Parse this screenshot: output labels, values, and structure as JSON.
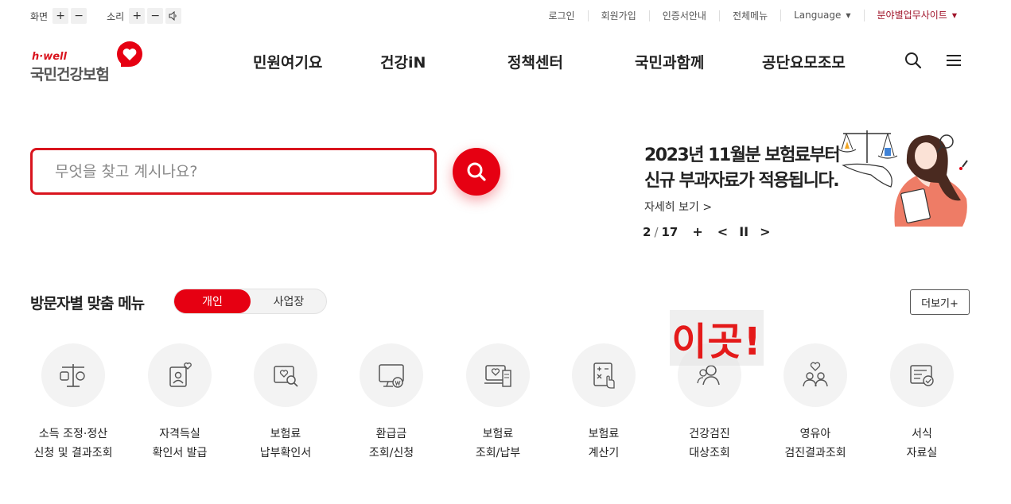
{
  "utility": {
    "screen_label": "화면",
    "sound_label": "소리",
    "plus": "+",
    "minus": "−",
    "links": [
      "로그인",
      "회원가입",
      "인증서안내",
      "전체메뉴",
      "Language",
      "분야별업무사이트"
    ]
  },
  "logo": {
    "tagline": "h·well",
    "name": "국민건강보험"
  },
  "gnb": [
    "민원여기요",
    "건강iN",
    "정책센터",
    "국민과함께",
    "공단요모조모"
  ],
  "search": {
    "placeholder": "무엇을 찾고 계시나요?"
  },
  "banner": {
    "title_line1": "2023년 11월분 보험료부터",
    "title_line2": "신규 부과자료가 적용됩니다.",
    "more_label": "자세히 보기",
    "more_arrow": ">",
    "page_current": "2",
    "page_sep": "/",
    "page_total": "17",
    "ctrl_plus": "+",
    "ctrl_prev": "<",
    "ctrl_pause": "II",
    "ctrl_next": ">"
  },
  "visitor_menu": {
    "title": "방문자별 맞춤 메뉴",
    "tabs": [
      "개인",
      "사업장"
    ],
    "more_label": "더보기+",
    "items": [
      {
        "line1": "소득 조정·정산",
        "line2": "신청 및 결과조회",
        "icon": "scale-icon"
      },
      {
        "line1": "자격득실",
        "line2": "확인서 발급",
        "icon": "id-card-heart-icon"
      },
      {
        "line1": "보험료",
        "line2": "납부확인서",
        "icon": "document-search-icon"
      },
      {
        "line1": "환급금",
        "line2": "조회/신청",
        "icon": "monitor-won-icon"
      },
      {
        "line1": "보험료",
        "line2": "조회/납부",
        "icon": "laptop-receipt-icon"
      },
      {
        "line1": "보험료",
        "line2": "계산기",
        "icon": "calculator-icon"
      },
      {
        "line1": "건강검진",
        "line2": "대상조회",
        "icon": "people-search-icon"
      },
      {
        "line1": "영유아",
        "line2": "검진결과조회",
        "icon": "family-heart-icon"
      },
      {
        "line1": "서식",
        "line2": "자료실",
        "icon": "form-check-icon"
      }
    ]
  },
  "overlay": {
    "sticker_text": "이곳!"
  },
  "colors": {
    "brand_red": "#e60012",
    "accent_dark_red": "#a0142a",
    "icon_gray": "#555555"
  }
}
